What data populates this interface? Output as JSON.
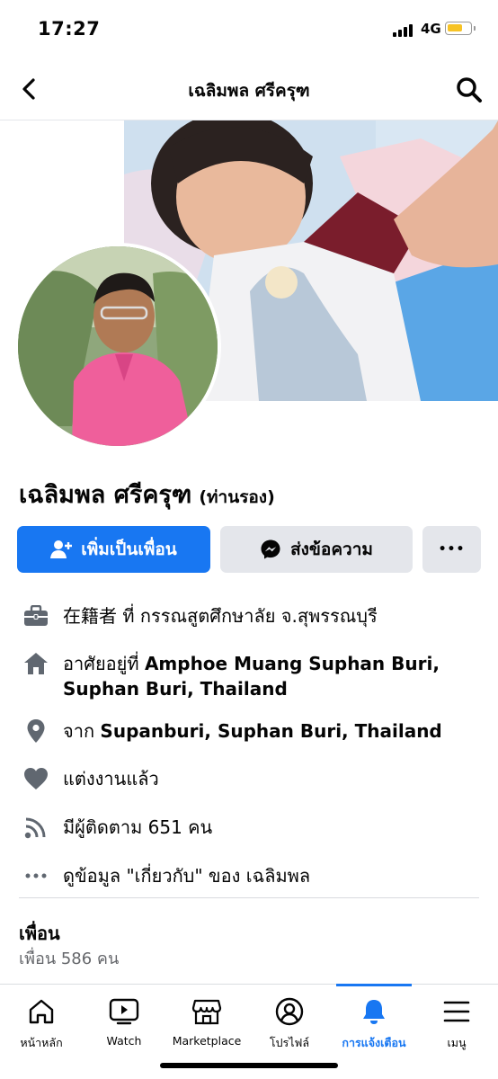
{
  "status_bar": {
    "time": "17:27",
    "network": "4G"
  },
  "header": {
    "title": "เฉลิมพล ศรีครุฑ"
  },
  "profile": {
    "name": "เฉลิมพล ศรีครุฑ",
    "nickname": "(ท่านรอง)"
  },
  "actions": {
    "add_friend": "เพิ่มเป็นเพื่อน",
    "message": "ส่งข้อความ",
    "more": "•••"
  },
  "info": {
    "work_prefix": "在籍者 ที่ ",
    "work_place": "กรรณสูตศึกษาลัย จ.สุพรรณบุรี",
    "lives_prefix": "อาศัยอยู่ที่ ",
    "lives_line1": "Amphoe Muang Suphan Buri,",
    "lives_line2": "Suphan Buri, Thailand",
    "from_prefix": "จาก ",
    "from_place": "Supanburi, Suphan Buri, Thailand",
    "relationship": "แต่งงานแล้ว",
    "followers": "มีผู้ติดตาม 651 คน",
    "about_link": "ดูข้อมูล \"เกี่ยวกับ\" ของ เฉลิมพล"
  },
  "friends": {
    "title": "เพื่อน",
    "count": "เพื่อน 586 คน"
  },
  "tabs": [
    {
      "label": "หน้าหลัก",
      "icon": "home-icon"
    },
    {
      "label": "Watch",
      "icon": "watch-icon"
    },
    {
      "label": "Marketplace",
      "icon": "marketplace-icon"
    },
    {
      "label": "โปรไฟล์",
      "icon": "profile-icon"
    },
    {
      "label": "การแจ้งเตือน",
      "icon": "bell-icon"
    },
    {
      "label": "เมนู",
      "icon": "menu-icon"
    }
  ],
  "colors": {
    "accent": "#1877f2",
    "button_gray": "#e4e6eb",
    "secondary_text": "#65676b",
    "battery": "#f7c325"
  }
}
